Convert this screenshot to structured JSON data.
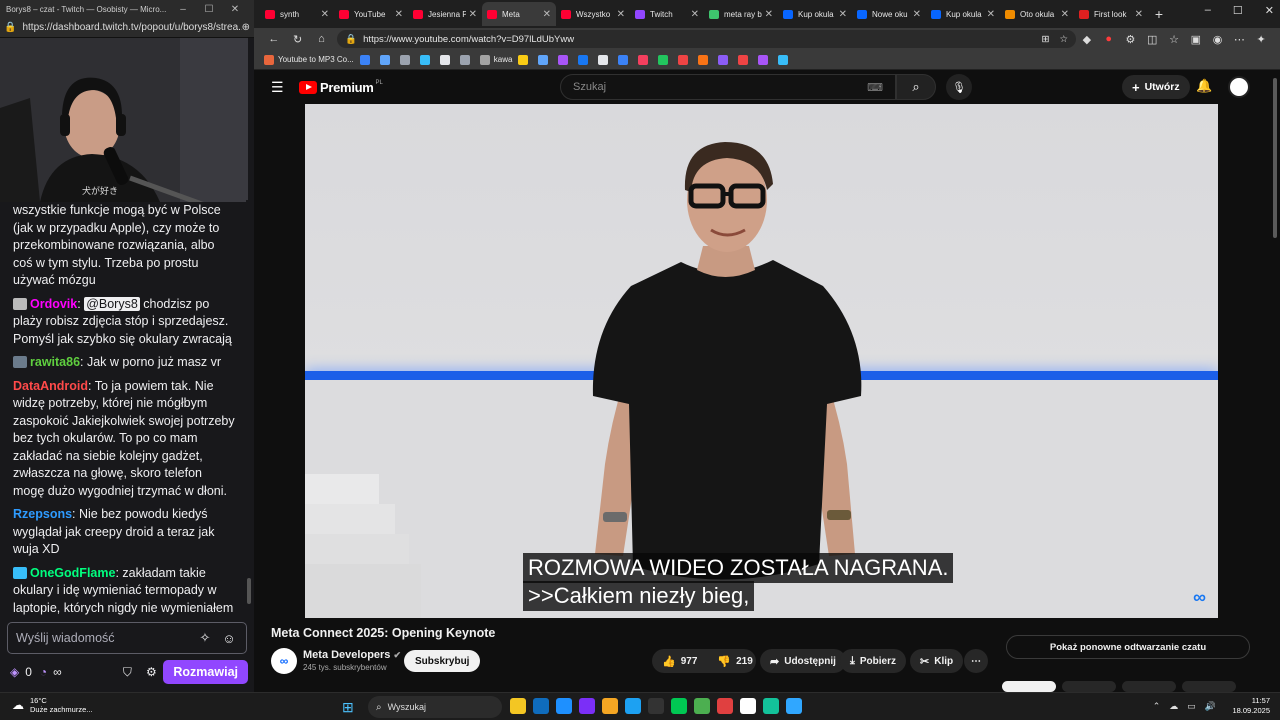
{
  "twitch": {
    "window_title": "Borys8 – czat - Twitch — Osobisty — Micro...",
    "url": "https://dashboard.twitch.tv/popout/u/borys8/strea...",
    "messages": [
      {
        "user": "",
        "color": "#efeff1",
        "text": "wszystkie funkcje mogą być w Polsce (jak w przypadku Apple), czy może to przekombinowane rozwiązania, albo coś w tym stylu. Trzeba po prostu używać mózgu"
      },
      {
        "user": "Ordovik",
        "color": "#ff00ff",
        "mention": "@Borys8",
        "text": "chodzisz po plaży robisz zdjęcia stóp i sprzedajesz. Pomyśl jak szybko się okulary zwracają"
      },
      {
        "user": "rawita86",
        "color": "#5fcf3f",
        "text": "Jak w porno już masz vr"
      },
      {
        "user": "DataAndroid",
        "color": "#ff4a4a",
        "text": "To ja powiem tak. Nie widzę potrzeby, której nie mógłbym zaspokoić Jakiejkolwiek swojej potrzeby bez tych okularów. To po co mam zakładać na siebie kolejny gadżet, zwłaszcza na głowę, skoro telefon mogę dużo wygodniej trzymać w dłoni."
      },
      {
        "user": "Rzepsons",
        "color": "#2e9bff",
        "text": "Nie bez powodu kiedyś wyglądał jak creepy droid a teraz jak wuja XD"
      },
      {
        "user": "OneGodFlame",
        "color": "#00ff7f",
        "text": "zakładam takie okulary i idę wymieniać termopady w laptopie, których nigdy nie wymieniałem"
      }
    ],
    "input_placeholder": "Wyślij wiadomość",
    "points": "0",
    "infinity": "∞",
    "send_label": "Rozmawiaj"
  },
  "browser": {
    "tabs": [
      {
        "title": "synth",
        "color": "#ff0033",
        "active": false
      },
      {
        "title": "YouTube",
        "color": "#ff0033",
        "active": false
      },
      {
        "title": "Jesienna P",
        "color": "#ff0033",
        "active": false
      },
      {
        "title": "Meta",
        "color": "#ff0033",
        "active": true
      },
      {
        "title": "Wszystko",
        "color": "#ff0033",
        "active": false
      },
      {
        "title": "Twitch",
        "color": "#9146ff",
        "active": false
      },
      {
        "title": "meta ray b",
        "color": "#3ec46d",
        "active": false
      },
      {
        "title": "Kup okula",
        "color": "#0866ff",
        "active": false
      },
      {
        "title": "Nowe oku",
        "color": "#0866ff",
        "active": false
      },
      {
        "title": "Kup okula",
        "color": "#0866ff",
        "active": false
      },
      {
        "title": "Oto okula",
        "color": "#f08c00",
        "active": false
      },
      {
        "title": "First look",
        "color": "#e02020",
        "active": false
      }
    ],
    "url": "https://www.youtube.com/watch?v=D97lLdUbYww",
    "bookmarks": [
      {
        "label": "Youtube to MP3 Co...",
        "color": "#e8663c"
      },
      {
        "label": "",
        "color": "#3b82f6"
      },
      {
        "label": "",
        "color": "#60a5fa"
      },
      {
        "label": "",
        "color": "#9ca3af"
      },
      {
        "label": "",
        "color": "#38bdf8"
      },
      {
        "label": "",
        "color": "#e5e7eb"
      },
      {
        "label": "",
        "color": "#9ca3af"
      },
      {
        "label": "kawa",
        "color": "#a3a3a3"
      },
      {
        "label": "",
        "color": "#facc15"
      },
      {
        "label": "",
        "color": "#60a5fa"
      },
      {
        "label": "",
        "color": "#a855f7"
      },
      {
        "label": "",
        "color": "#1877f2"
      },
      {
        "label": "",
        "color": "#e5e7eb"
      },
      {
        "label": "",
        "color": "#3b82f6"
      },
      {
        "label": "",
        "color": "#f43f5e"
      },
      {
        "label": "",
        "color": "#22c55e"
      },
      {
        "label": "",
        "color": "#ef4444"
      },
      {
        "label": "",
        "color": "#f97316"
      },
      {
        "label": "",
        "color": "#8b5cf6"
      },
      {
        "label": "",
        "color": "#ef4444"
      },
      {
        "label": "",
        "color": "#a855f7"
      },
      {
        "label": "",
        "color": "#38bdf8"
      }
    ]
  },
  "youtube": {
    "brand": "Premium",
    "region": "PL",
    "search_placeholder": "Szukaj",
    "create_label": "Utwórz",
    "captions": [
      "ROZMOWA WIDEO ZOSTAŁA NAGRANA.",
      ">>Całkiem niezły bieg,"
    ],
    "video_title": "Meta Connect 2025: Opening Keynote",
    "channel_name": "Meta Developers",
    "verified": "✔",
    "subscribers": "245 tys. subskrybentów",
    "subscribe_label": "Subskrybuj",
    "likes": "977",
    "dislikes": "219",
    "share_label": "Udostępnij",
    "download_label": "Pobierz",
    "clip_label": "Klip",
    "replay_chat_label": "Pokaż ponowne odtwarzanie czatu",
    "watermark": "∞"
  },
  "taskbar": {
    "temperature": "16°C",
    "weather": "Duże zachmurze...",
    "search_label": "Wyszukaj",
    "apps": [
      "#f3c623",
      "#0f6cbd",
      "#1e90ff",
      "#7b2ff7",
      "#f5a623",
      "#1da1f2",
      "#333333",
      "#00c853",
      "#4caf50",
      "#e04040",
      "#ffffff",
      "#13c29a",
      "#30a7ff"
    ],
    "time": "11:57",
    "date": "18.09.2025"
  }
}
